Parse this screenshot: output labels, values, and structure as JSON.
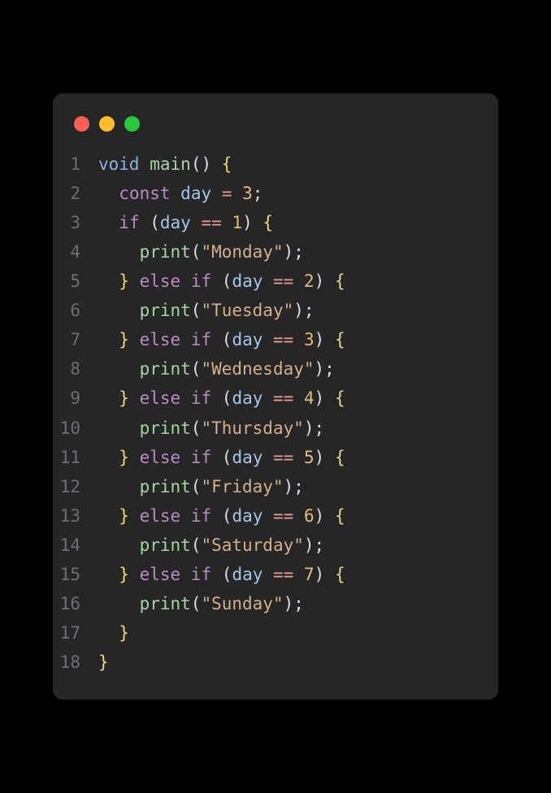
{
  "colors": {
    "close": "#ff5f56",
    "minimize": "#ffbd2e",
    "zoom": "#27c93f"
  },
  "code": {
    "lines": [
      {
        "n": "1",
        "tokens": [
          [
            "kw-type",
            "void"
          ],
          [
            "pun",
            " "
          ],
          [
            "kw-fn",
            "main"
          ],
          [
            "pun",
            "() "
          ],
          [
            "brace",
            "{"
          ]
        ]
      },
      {
        "n": "2",
        "indent": "  ",
        "tokens": [
          [
            "kw-const",
            "const"
          ],
          [
            "pun",
            " "
          ],
          [
            "var",
            "day"
          ],
          [
            "pun",
            " "
          ],
          [
            "op",
            "="
          ],
          [
            "pun",
            " "
          ],
          [
            "num",
            "3"
          ],
          [
            "pun",
            ";"
          ]
        ]
      },
      {
        "n": "3",
        "indent": "  ",
        "tokens": [
          [
            "kw-ctrl",
            "if"
          ],
          [
            "pun",
            " ("
          ],
          [
            "var",
            "day"
          ],
          [
            "pun",
            " "
          ],
          [
            "op",
            "=="
          ],
          [
            "pun",
            " "
          ],
          [
            "num",
            "1"
          ],
          [
            "pun",
            ") "
          ],
          [
            "brace",
            "{"
          ]
        ]
      },
      {
        "n": "4",
        "indent": "    ",
        "tokens": [
          [
            "kw-fn",
            "print"
          ],
          [
            "pun",
            "("
          ],
          [
            "str",
            "\"Monday\""
          ],
          [
            "pun",
            ");"
          ]
        ]
      },
      {
        "n": "5",
        "indent": "  ",
        "tokens": [
          [
            "brace",
            "}"
          ],
          [
            "pun",
            " "
          ],
          [
            "kw-ctrl",
            "else"
          ],
          [
            "pun",
            " "
          ],
          [
            "kw-ctrl",
            "if"
          ],
          [
            "pun",
            " ("
          ],
          [
            "var",
            "day"
          ],
          [
            "pun",
            " "
          ],
          [
            "op",
            "=="
          ],
          [
            "pun",
            " "
          ],
          [
            "num",
            "2"
          ],
          [
            "pun",
            ") "
          ],
          [
            "brace",
            "{"
          ]
        ]
      },
      {
        "n": "6",
        "indent": "    ",
        "tokens": [
          [
            "kw-fn",
            "print"
          ],
          [
            "pun",
            "("
          ],
          [
            "str",
            "\"Tuesday\""
          ],
          [
            "pun",
            ");"
          ]
        ]
      },
      {
        "n": "7",
        "indent": "  ",
        "tokens": [
          [
            "brace",
            "}"
          ],
          [
            "pun",
            " "
          ],
          [
            "kw-ctrl",
            "else"
          ],
          [
            "pun",
            " "
          ],
          [
            "kw-ctrl",
            "if"
          ],
          [
            "pun",
            " ("
          ],
          [
            "var",
            "day"
          ],
          [
            "pun",
            " "
          ],
          [
            "op",
            "=="
          ],
          [
            "pun",
            " "
          ],
          [
            "num",
            "3"
          ],
          [
            "pun",
            ") "
          ],
          [
            "brace",
            "{"
          ]
        ]
      },
      {
        "n": "8",
        "indent": "    ",
        "tokens": [
          [
            "kw-fn",
            "print"
          ],
          [
            "pun",
            "("
          ],
          [
            "str",
            "\"Wednesday\""
          ],
          [
            "pun",
            ");"
          ]
        ]
      },
      {
        "n": "9",
        "indent": "  ",
        "tokens": [
          [
            "brace",
            "}"
          ],
          [
            "pun",
            " "
          ],
          [
            "kw-ctrl",
            "else"
          ],
          [
            "pun",
            " "
          ],
          [
            "kw-ctrl",
            "if"
          ],
          [
            "pun",
            " ("
          ],
          [
            "var",
            "day"
          ],
          [
            "pun",
            " "
          ],
          [
            "op",
            "=="
          ],
          [
            "pun",
            " "
          ],
          [
            "num",
            "4"
          ],
          [
            "pun",
            ") "
          ],
          [
            "brace",
            "{"
          ]
        ]
      },
      {
        "n": "10",
        "indent": "    ",
        "tokens": [
          [
            "kw-fn",
            "print"
          ],
          [
            "pun",
            "("
          ],
          [
            "str",
            "\"Thursday\""
          ],
          [
            "pun",
            ");"
          ]
        ]
      },
      {
        "n": "11",
        "indent": "  ",
        "tokens": [
          [
            "brace",
            "}"
          ],
          [
            "pun",
            " "
          ],
          [
            "kw-ctrl",
            "else"
          ],
          [
            "pun",
            " "
          ],
          [
            "kw-ctrl",
            "if"
          ],
          [
            "pun",
            " ("
          ],
          [
            "var",
            "day"
          ],
          [
            "pun",
            " "
          ],
          [
            "op",
            "=="
          ],
          [
            "pun",
            " "
          ],
          [
            "num",
            "5"
          ],
          [
            "pun",
            ") "
          ],
          [
            "brace",
            "{"
          ]
        ]
      },
      {
        "n": "12",
        "indent": "    ",
        "tokens": [
          [
            "kw-fn",
            "print"
          ],
          [
            "pun",
            "("
          ],
          [
            "str",
            "\"Friday\""
          ],
          [
            "pun",
            ");"
          ]
        ]
      },
      {
        "n": "13",
        "indent": "  ",
        "tokens": [
          [
            "brace",
            "}"
          ],
          [
            "pun",
            " "
          ],
          [
            "kw-ctrl",
            "else"
          ],
          [
            "pun",
            " "
          ],
          [
            "kw-ctrl",
            "if"
          ],
          [
            "pun",
            " ("
          ],
          [
            "var",
            "day"
          ],
          [
            "pun",
            " "
          ],
          [
            "op",
            "=="
          ],
          [
            "pun",
            " "
          ],
          [
            "num",
            "6"
          ],
          [
            "pun",
            ") "
          ],
          [
            "brace",
            "{"
          ]
        ]
      },
      {
        "n": "14",
        "indent": "    ",
        "tokens": [
          [
            "kw-fn",
            "print"
          ],
          [
            "pun",
            "("
          ],
          [
            "str",
            "\"Saturday\""
          ],
          [
            "pun",
            ");"
          ]
        ]
      },
      {
        "n": "15",
        "indent": "  ",
        "tokens": [
          [
            "brace",
            "}"
          ],
          [
            "pun",
            " "
          ],
          [
            "kw-ctrl",
            "else"
          ],
          [
            "pun",
            " "
          ],
          [
            "kw-ctrl",
            "if"
          ],
          [
            "pun",
            " ("
          ],
          [
            "var",
            "day"
          ],
          [
            "pun",
            " "
          ],
          [
            "op",
            "=="
          ],
          [
            "pun",
            " "
          ],
          [
            "num",
            "7"
          ],
          [
            "pun",
            ") "
          ],
          [
            "brace",
            "{"
          ]
        ]
      },
      {
        "n": "16",
        "indent": "    ",
        "tokens": [
          [
            "kw-fn",
            "print"
          ],
          [
            "pun",
            "("
          ],
          [
            "str",
            "\"Sunday\""
          ],
          [
            "pun",
            ");"
          ]
        ]
      },
      {
        "n": "17",
        "indent": "  ",
        "tokens": [
          [
            "brace",
            "}"
          ]
        ]
      },
      {
        "n": "18",
        "tokens": [
          [
            "brace",
            "}"
          ]
        ]
      }
    ]
  }
}
